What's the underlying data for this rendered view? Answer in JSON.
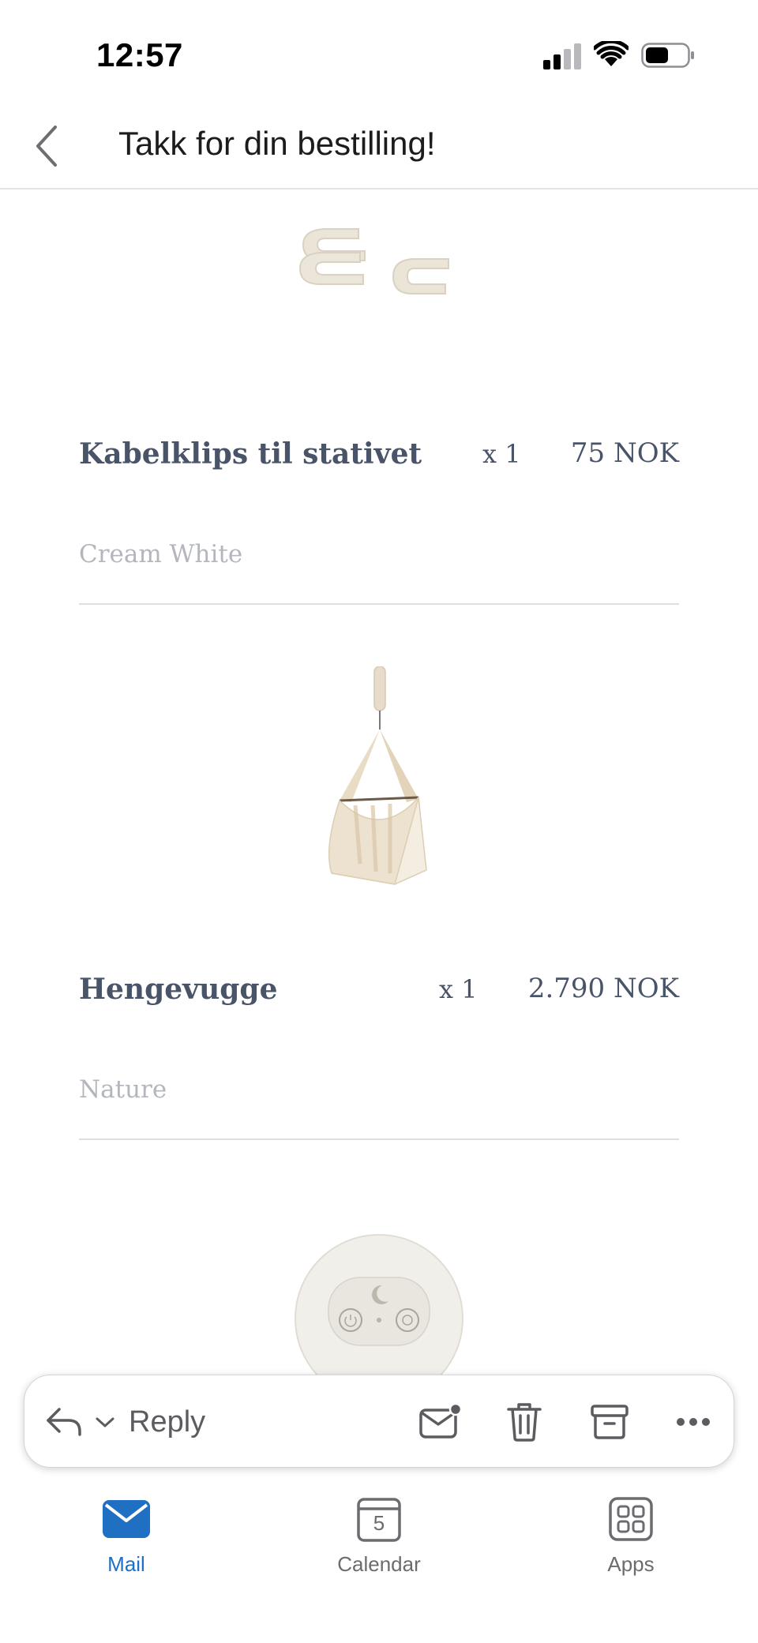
{
  "status_bar": {
    "time": "12:57"
  },
  "nav": {
    "title": "Takk for din bestilling!"
  },
  "order_items": [
    {
      "name": "Kabelklips til stativet",
      "quantity": "x 1",
      "price": "75 NOK",
      "variant": "Cream White"
    },
    {
      "name": "Hengevugge",
      "quantity": "x 1",
      "price": "2.790 NOK",
      "variant": "Nature"
    }
  ],
  "toolbar": {
    "reply_label": "Reply"
  },
  "tabs": [
    {
      "label": "Mail",
      "icon": "mail-icon",
      "active": true
    },
    {
      "label": "Calendar",
      "icon": "calendar-icon",
      "active": false,
      "badge": "5"
    },
    {
      "label": "Apps",
      "icon": "apps-grid-icon",
      "active": false
    }
  ],
  "colors": {
    "accent": "#1f6fc2",
    "product_text": "#4a5468",
    "variant_text": "#b3b6bd",
    "product_cream": "#ece6da"
  }
}
